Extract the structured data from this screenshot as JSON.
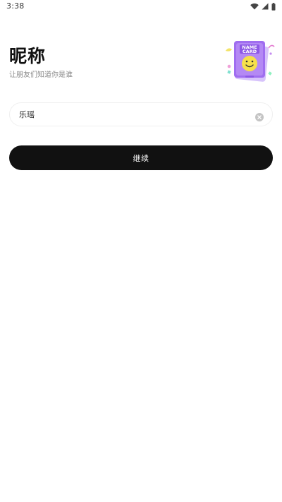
{
  "status_bar": {
    "time": "3:38",
    "icons": [
      "wifi-icon",
      "signal-icon",
      "battery-icon"
    ]
  },
  "header": {
    "title": "昵称",
    "subtitle": "让朋友们知道你是谁"
  },
  "illustration": {
    "name": "name-card-illustration",
    "card_text_line1": "NAME",
    "card_text_line2": "CARD"
  },
  "nickname_field": {
    "value": "乐瑶",
    "clear_icon": "clear-icon"
  },
  "continue_button": {
    "label": "继续"
  },
  "colors": {
    "button_bg": "#111111",
    "button_text": "#ffffff",
    "card_purple": "#a06ef0",
    "smiley_yellow": "#f7e14a",
    "subtitle_gray": "#8a8a8a"
  }
}
